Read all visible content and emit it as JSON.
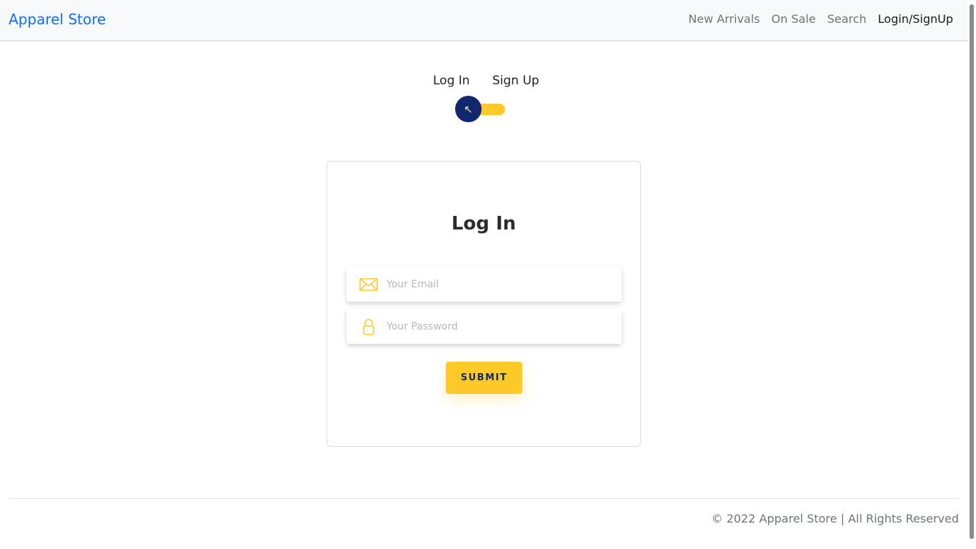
{
  "navbar": {
    "brand": "Apparel Store",
    "links": [
      "New Arrivals",
      "On Sale",
      "Search",
      "Login/SignUp"
    ],
    "active_link": "Login/SignUp"
  },
  "toggle": {
    "login_label": "Log In",
    "signup_label": "Sign Up",
    "knob_icon": "arrow-up-left-icon",
    "state": "Log In"
  },
  "form": {
    "title": "Log In",
    "email": {
      "placeholder": "Your Email",
      "value": "",
      "icon": "envelope-icon"
    },
    "password": {
      "placeholder": "Your Password",
      "value": "",
      "icon": "lock-icon"
    },
    "submit_label": "SUBMIT"
  },
  "footer": {
    "text": "© 2022 Apparel Store | All Rights Reserved"
  },
  "colors": {
    "brand": "#0d6efd",
    "accent": "#ffc928",
    "knob": "#102770"
  }
}
